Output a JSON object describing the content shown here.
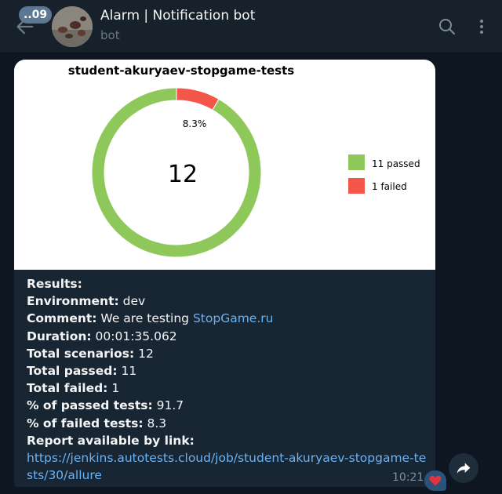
{
  "header": {
    "unread_count": "..09",
    "title": "Alarm | Notification bot",
    "subtitle": "bot"
  },
  "message": {
    "time": "10:21",
    "reaction": "❤️",
    "lines": {
      "results_label": "Results:",
      "environment_label": "Environment:",
      "environment_value": " dev",
      "comment_label": "Comment:",
      "comment_value": " We are testing ",
      "comment_link": "StopGame.ru",
      "duration_label": "Duration:",
      "duration_value": " 00:01:35.062",
      "total_scenarios_label": "Total scenarios:",
      "total_scenarios_value": " 12",
      "total_passed_label": "Total passed:",
      "total_passed_value": " 11",
      "total_failed_label": "Total failed:",
      "total_failed_value": " 1",
      "pct_passed_label": "% of passed tests:",
      "pct_passed_value": " 91.7",
      "pct_failed_label": "% of failed tests:",
      "pct_failed_value": " 8.3",
      "report_label": "Report available by link:",
      "report_url": "https://jenkins.autotests.cloud/job/student-akuryaev-stopgame-tests/30/allure"
    }
  },
  "chart_data": {
    "type": "pie",
    "title": "student-akuryaev-stopgame-tests",
    "center_label": "12",
    "slices": [
      {
        "name": "passed",
        "legend": "11 passed",
        "value": 11,
        "color": "#8ec85a"
      },
      {
        "name": "failed",
        "legend": "1 failed",
        "value": 1,
        "color": "#f4574a",
        "percent_label": "8.3%"
      }
    ],
    "legend_placement": "right"
  }
}
